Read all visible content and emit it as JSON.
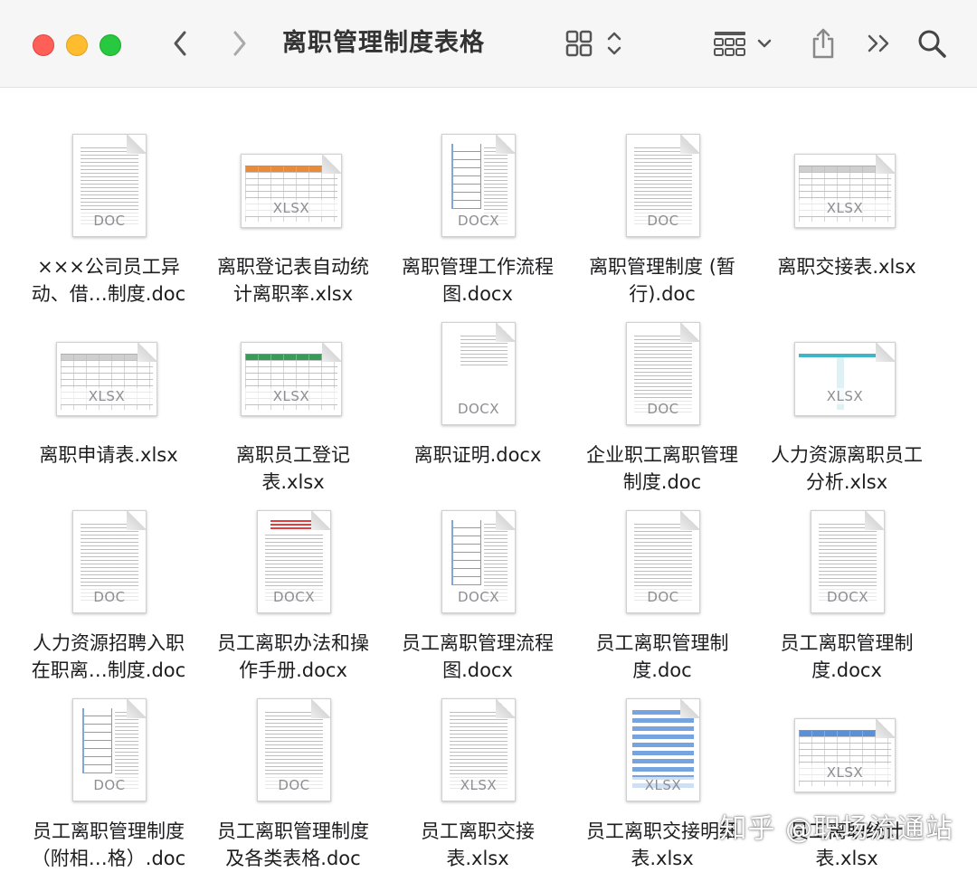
{
  "window": {
    "title": "离职管理制度表格",
    "controls": [
      "close",
      "minimize",
      "zoom"
    ]
  },
  "toolbar": {
    "back_icon": "chevron-left-icon",
    "forward_icon": "chevron-right-icon",
    "view_icon": "grid-view-icon",
    "group_icon": "group-by-icon",
    "share_icon": "share-icon",
    "more_icon": "more-chevrons-icon",
    "search_icon": "search-icon"
  },
  "files": [
    {
      "name_line1": "×××公司员工异",
      "name_line2": "动、借…制度.doc",
      "badge": "DOC",
      "kind": "doc"
    },
    {
      "name_line1": "离职登记表自动统",
      "name_line2": "计离职率.xlsx",
      "badge": "XLSX",
      "kind": "sheet",
      "head": "#e88b3a"
    },
    {
      "name_line1": "离职管理工作流程",
      "name_line2": "图.docx",
      "badge": "DOCX",
      "kind": "flow"
    },
    {
      "name_line1": "离职管理制度 (暂",
      "name_line2": "行).doc",
      "badge": "DOC",
      "kind": "doc"
    },
    {
      "name_line1": "离职交接表.xlsx",
      "name_line2": "",
      "badge": "XLSX",
      "kind": "sheet",
      "head": "#cfcfcf"
    },
    {
      "name_line1": "离职申请表.xlsx",
      "name_line2": "",
      "badge": "XLSX",
      "kind": "sheet",
      "head": "#cfcfcf"
    },
    {
      "name_line1": "离职员工登记",
      "name_line2": "表.xlsx",
      "badge": "XLSX",
      "kind": "sheet",
      "head": "#3a9a5a"
    },
    {
      "name_line1": "离职证明.docx",
      "name_line2": "",
      "badge": "DOCX",
      "kind": "sparse"
    },
    {
      "name_line1": "企业职工离职管理",
      "name_line2": "制度.doc",
      "badge": "DOC",
      "kind": "doc"
    },
    {
      "name_line1": "人力资源离职员工",
      "name_line2": "分析.xlsx",
      "badge": "XLSX",
      "kind": "sheet-blank",
      "head": "#3fb6c8"
    },
    {
      "name_line1": "人力资源招聘入职",
      "name_line2": "在职离…制度.doc",
      "badge": "DOC",
      "kind": "doc"
    },
    {
      "name_line1": "员工离职办法和操",
      "name_line2": "作手册.docx",
      "badge": "DOCX",
      "kind": "red"
    },
    {
      "name_line1": "员工离职管理流程",
      "name_line2": "图.docx",
      "badge": "DOCX",
      "kind": "flow"
    },
    {
      "name_line1": "员工离职管理制",
      "name_line2": "度.doc",
      "badge": "DOC",
      "kind": "doc"
    },
    {
      "name_line1": "员工离职管理制",
      "name_line2": "度.docx",
      "badge": "DOCX",
      "kind": "doc"
    },
    {
      "name_line1": "员工离职管理制度",
      "name_line2": "（附相…格）.doc",
      "badge": "DOC",
      "kind": "flow"
    },
    {
      "name_line1": "员工离职管理制度",
      "name_line2": "及各类表格.doc",
      "badge": "DOC",
      "kind": "doc"
    },
    {
      "name_line1": "员工离职交接",
      "name_line2": "表.xlsx",
      "badge": "XLSX",
      "kind": "doc"
    },
    {
      "name_line1": "员工离职交接明细",
      "name_line2": "表.xlsx",
      "badge": "XLSX",
      "kind": "blue"
    },
    {
      "name_line1": "员工离职统计",
      "name_line2": "表.xlsx",
      "badge": "XLSX",
      "kind": "sheet",
      "head": "#5b8fd6"
    }
  ],
  "watermark": "知乎 @职场流通站"
}
